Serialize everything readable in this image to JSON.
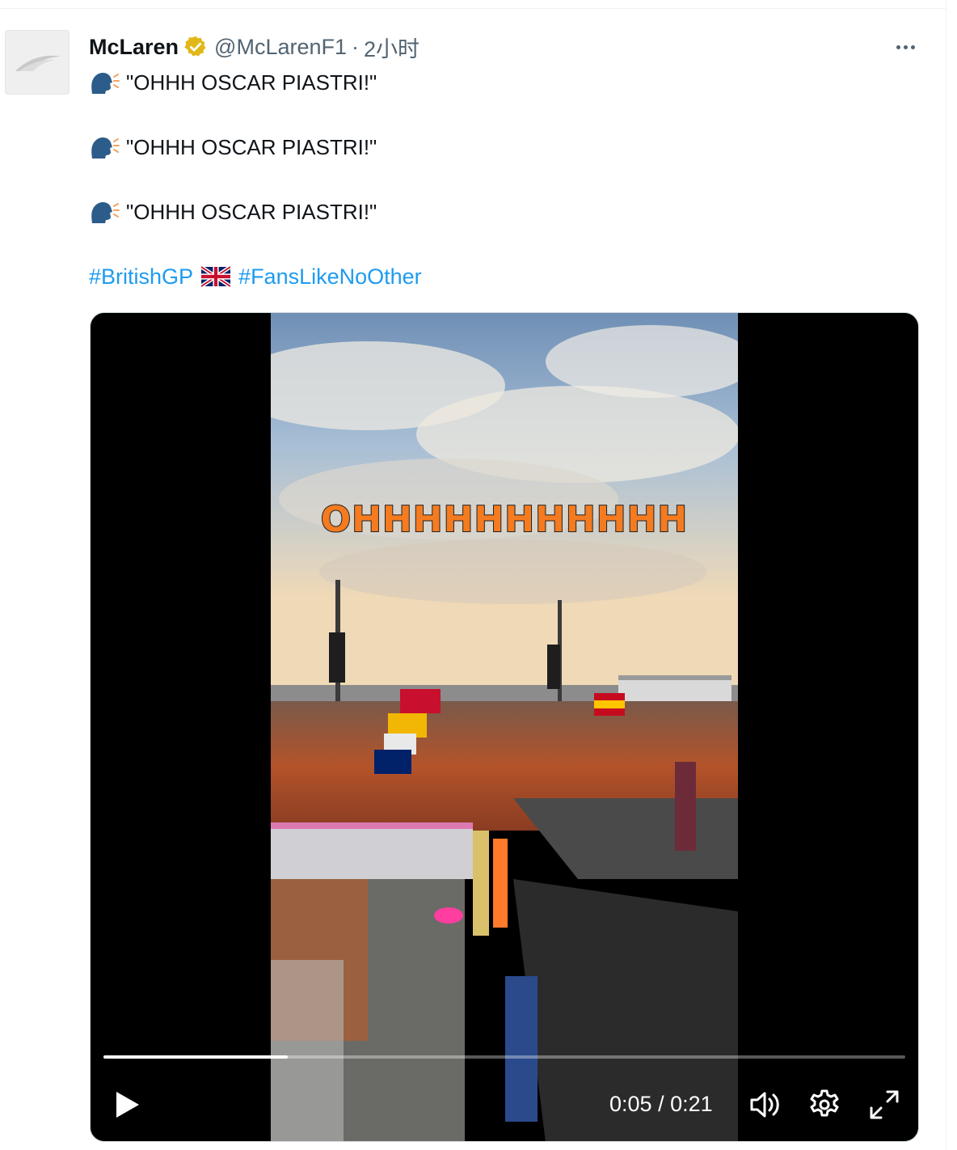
{
  "tweet": {
    "author_name": "McLaren",
    "handle": "@McLarenF1",
    "separator": "·",
    "time": "2小时",
    "lines": [
      "\"OHHH OSCAR PIASTRI!\"",
      "\"OHHH OSCAR PIASTRI!\"",
      "\"OHHH OSCAR PIASTRI!\""
    ],
    "hashtags": [
      "#BritishGP",
      "#FansLikeNoOther"
    ],
    "icons": {
      "avatar": "mclaren-speedmark-logo",
      "verified": "gold-verified-badge-icon",
      "more": "more-options-icon",
      "line_emoji": "speaking-head-icon",
      "flag": "uk-flag-icon"
    },
    "colors": {
      "link": "#1d9bf0",
      "badge": "#e2b719",
      "secondary_text": "#536471"
    }
  },
  "video": {
    "caption": "OHHHHHHHHHHH",
    "current_time": "0:05",
    "time_separator": " / ",
    "duration": "0:21",
    "progress": 0.23,
    "controls": [
      "play-icon",
      "volume-icon",
      "settings-gear-icon",
      "fullscreen-icon"
    ]
  }
}
